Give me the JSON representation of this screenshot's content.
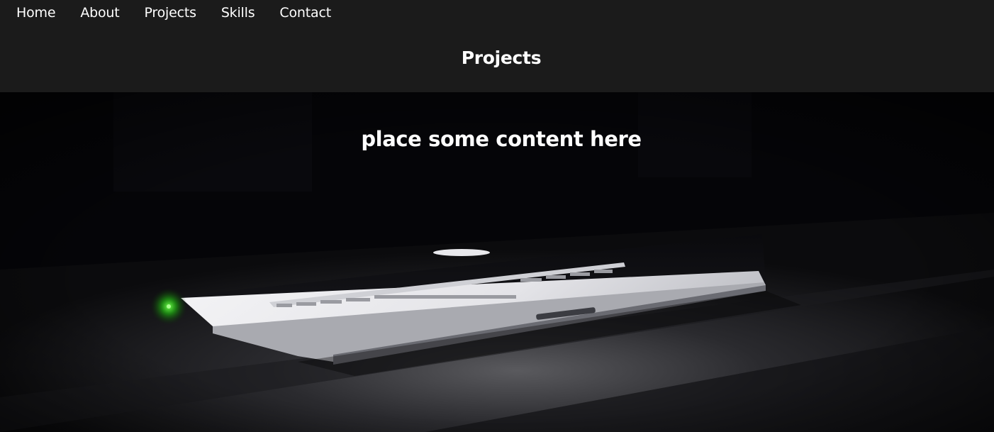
{
  "nav": {
    "items": [
      {
        "label": "Home"
      },
      {
        "label": "About"
      },
      {
        "label": "Projects"
      },
      {
        "label": "Skills"
      },
      {
        "label": "Contact"
      }
    ]
  },
  "header": {
    "title": "Projects"
  },
  "hero": {
    "text": "place some content here",
    "image_icon": "laptop-photo-icon"
  }
}
